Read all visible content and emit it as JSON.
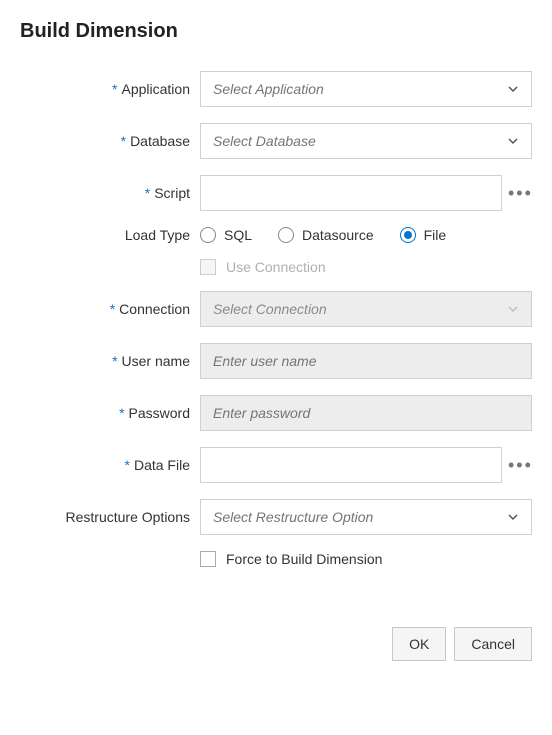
{
  "title": "Build Dimension",
  "fields": {
    "application": {
      "label": "Application",
      "placeholder": "Select Application",
      "required": true
    },
    "database": {
      "label": "Database",
      "placeholder": "Select Database",
      "required": true
    },
    "script": {
      "label": "Script",
      "required": true
    },
    "loadType": {
      "label": "Load Type",
      "options": {
        "sql": "SQL",
        "datasource": "Datasource",
        "file": "File"
      },
      "selected": "file"
    },
    "useConnection": {
      "label": "Use Connection",
      "checked": false,
      "disabled": true
    },
    "connection": {
      "label": "Connection",
      "placeholder": "Select Connection",
      "required": true,
      "disabled": true
    },
    "userName": {
      "label": "User name",
      "placeholder": "Enter user name",
      "required": true
    },
    "password": {
      "label": "Password",
      "placeholder": "Enter password",
      "required": true
    },
    "dataFile": {
      "label": "Data File",
      "required": true
    },
    "restructure": {
      "label": "Restructure Options",
      "placeholder": "Select Restructure Option",
      "required": false
    },
    "forceBuild": {
      "label": "Force to Build Dimension",
      "checked": false
    }
  },
  "buttons": {
    "ok": "OK",
    "cancel": "Cancel"
  }
}
